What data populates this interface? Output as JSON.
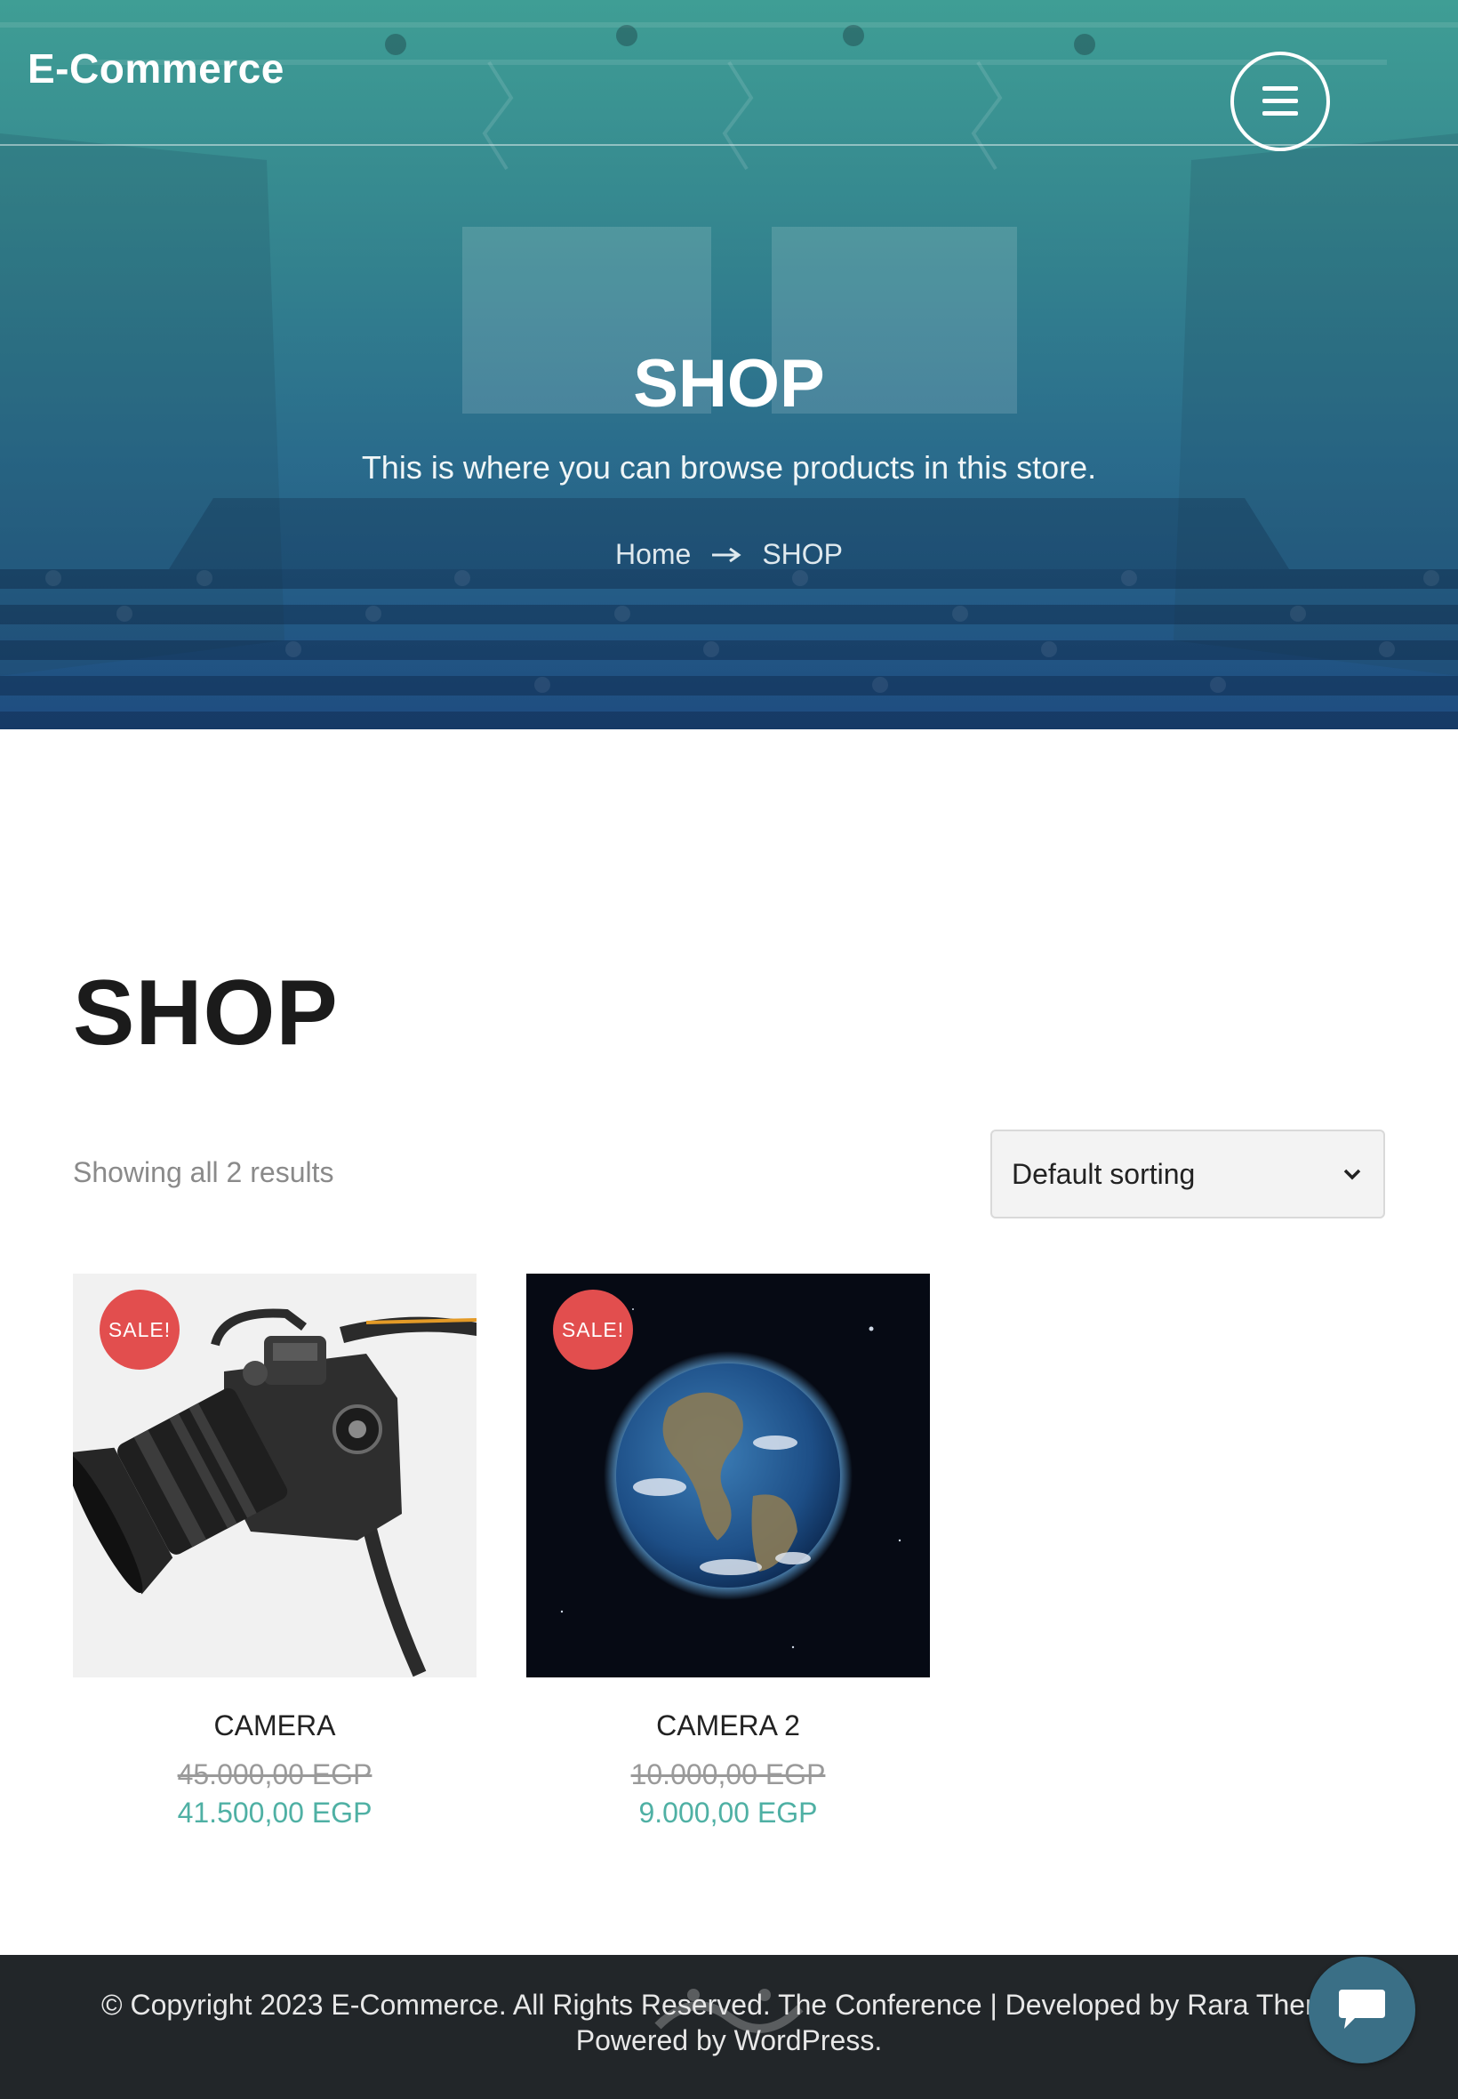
{
  "header": {
    "site_title": "E-Commerce",
    "menu_icon": "hamburger-icon"
  },
  "hero": {
    "title": "SHOP",
    "subtitle": "This is where you can browse products in this store.",
    "breadcrumb": {
      "home": "Home",
      "separator_icon": "arrow-right-icon",
      "current": "SHOP"
    }
  },
  "main": {
    "page_title": "SHOP",
    "result_count": "Showing all 2 results",
    "sort": {
      "selected": "Default sorting",
      "icon": "chevron-down-icon"
    },
    "products": [
      {
        "name": "CAMERA",
        "badge": "SALE!",
        "price_old": "45.000,00 EGP",
        "price_new": "41.500,00 EGP",
        "image": "dslr-camera"
      },
      {
        "name": "CAMERA 2",
        "badge": "SALE!",
        "price_old": "10.000,00 EGP",
        "price_new": "9.000,00 EGP",
        "image": "earth-from-space"
      }
    ]
  },
  "footer": {
    "copyright": "© Copyright 2023 E-Commerce. All Rights Reserved. The Conference | Developed by Rara Themes.",
    "powered_by": "Powered by WordPress.",
    "chat_icon": "chat-bubble-icon"
  },
  "colors": {
    "hero_top": "#3f9e95",
    "hero_bottom": "#1e4c80",
    "sale_badge": "#e24e4e",
    "price_accent": "#4fb0a4",
    "footer_bg": "#222629",
    "chat_button": "#3a6f86"
  }
}
